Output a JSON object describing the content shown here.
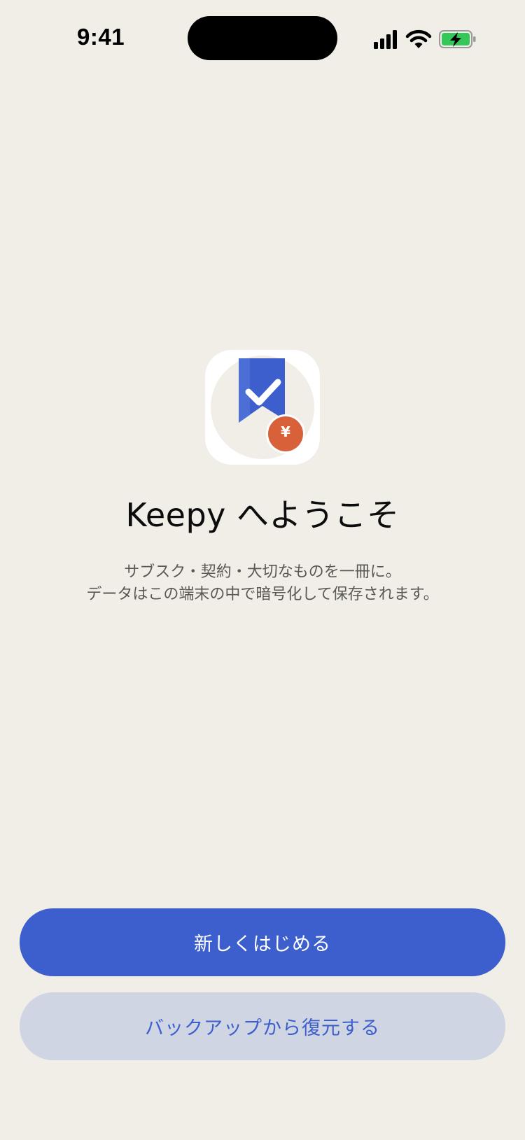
{
  "status_bar": {
    "time": "9:41",
    "icons": [
      "cellular-signal-icon",
      "wifi-icon",
      "battery-charging-icon"
    ]
  },
  "app": {
    "icon_name": "keepy-app-icon",
    "yen_symbol": "¥"
  },
  "welcome": {
    "title": "Keepy へようこそ",
    "description_line1": "サブスク・契約・大切なものを一冊に。",
    "description_line2": "データはこの端末の中で暗号化して保存されます。"
  },
  "actions": {
    "start_label": "新しくはじめる",
    "restore_label": "バックアップから復元する"
  },
  "colors": {
    "background": "#f1eee8",
    "accent_blue": "#3c5fcd",
    "secondary_button": "#cfd5e2",
    "yen_badge": "#d9613a",
    "battery_green": "#34c759"
  }
}
